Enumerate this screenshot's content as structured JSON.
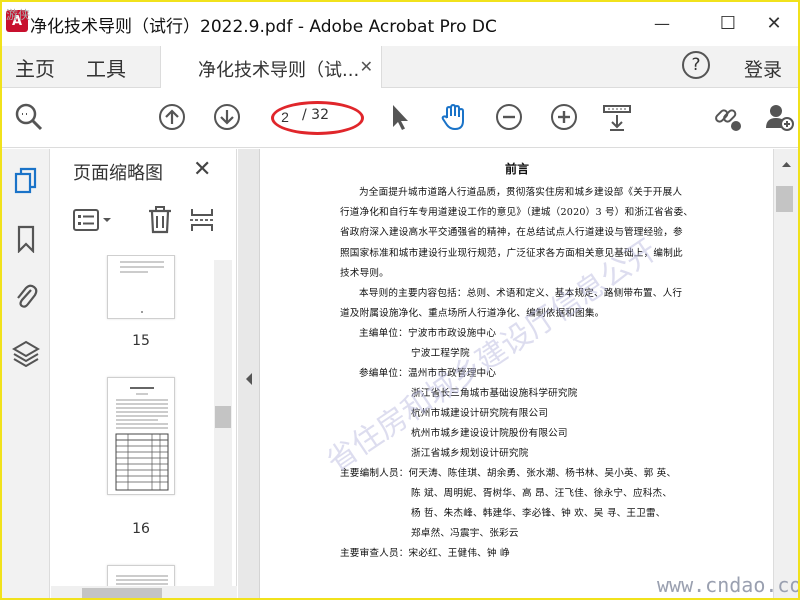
{
  "window": {
    "title": "净化技术导则（试行）2022.9.pdf - Adobe Acrobat Pro DC",
    "app_icon_glyph": "A",
    "minimize_glyph": "—",
    "maximize_glyph": "☐",
    "close_glyph": "✕"
  },
  "menu": {
    "home": "主页",
    "tools": "工具",
    "tab_label": "净化技术导则（试...",
    "tab_close": "✕",
    "help": "?",
    "login": "登录"
  },
  "toolbar": {
    "current_page": "2",
    "total_pages": "/ 32"
  },
  "panel": {
    "title": "页面缩略图",
    "close": "✕",
    "thumbnails": [
      {
        "label": "15"
      },
      {
        "label": "16"
      }
    ]
  },
  "document": {
    "heading": "前言",
    "lines": [
      "为全面提升城市道路人行道品质，贯彻落实住房和城乡建设部《关于开展人",
      "行道净化和自行车专用道建设工作的意见》（建城（2020）3 号）和浙江省省委、",
      "省政府深入建设高水平交通强省的精神，在总结试点人行道建设与管理经验，参",
      "照国家标准和城市建设行业现行规范，广泛征求各方面相关意见基础上，编制此",
      "技术导则。",
      "本导则的主要内容包括：总则、术语和定义、基本规定、路侧带布置、人行",
      "道及附属设施净化、重点场所人行道净化、编制依据和图集。",
      "主编单位：宁波市市政设施中心",
      "宁波工程学院",
      "参编单位：温州市市政管理中心",
      "浙江省长三角城市基础设施科学研究院",
      "杭州市城建设计研究院有限公司",
      "杭州市城乡建设设计院股份有限公司",
      "浙江省城乡规划设计研究院",
      "主要编制人员：何天涛、陈佳琪、胡余勇、张水潮、杨书林、吴小英、郭  英、",
      "陈  斌、周明妮、胥树华、高  昂、汪飞佳、徐永宁、应科杰、",
      "杨  哲、朱杰峰、韩建华、李必锋、钟  欢、吴  寻、王卫雷、",
      "郑卓然、冯震宇、张彩云",
      "主要审查人员：宋必红、王健伟、钟  峥"
    ]
  },
  "watermarks": {
    "diagonal_top": "省住房和城乡建设厅信息公开",
    "diagonal_bottom": "省住",
    "url": "www.cndao.com",
    "corner": "游侠"
  },
  "colors": {
    "highlight_ellipse": "#e0262b",
    "hand_tool": "#1a73c8",
    "frame": "#f1e21c"
  },
  "icons": {
    "zoom": "zoom-icon",
    "prev_page": "arrow-up-circle-icon",
    "next_page": "arrow-down-circle-icon",
    "select": "cursor-arrow-icon",
    "hand": "hand-icon",
    "zoom_out": "minus-circle-icon",
    "zoom_in": "plus-circle-icon",
    "scroll_mode": "scroll-mode-icon",
    "link": "link-icon",
    "add_user": "add-user-icon"
  }
}
